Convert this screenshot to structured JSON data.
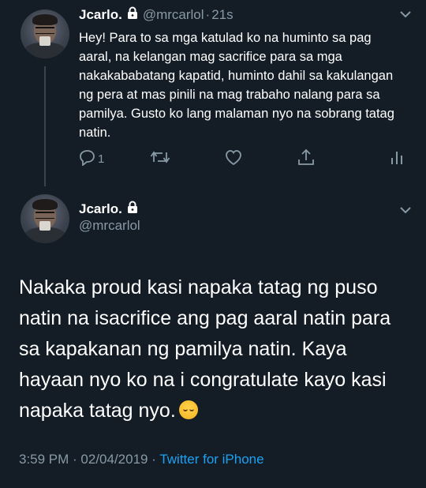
{
  "reply_tweet": {
    "author_name": "Jcarlo.",
    "handle": "@mrcarlol",
    "time": "21s",
    "text": "Hey! Para to sa mga katulad ko na huminto sa pag aaral, na kelangan mag sacrifice para sa mga nakakababatang kapatid, huminto dahil sa kakulangan ng pera at mas pinili na mag trabaho nalang para sa pamilya. Gusto ko lang malaman nyo na sobrang tatag natin.",
    "reply_count": "1",
    "icons": [
      "reply-icon",
      "retweet-icon",
      "like-icon",
      "share-icon",
      "analytics-icon"
    ]
  },
  "main_tweet": {
    "author_name": "Jcarlo.",
    "handle": "@mrcarlol",
    "text": "Nakaka proud kasi napaka tatag ng puso natin na isacrifice ang pag aaral natin para sa kapakanan ng pamilya natin. Kaya hayaan nyo ko na i congratulate kayo kasi napaka tatag nyo.",
    "emoji": "relieved-smile-emoji",
    "timestamp": "3:59 PM · 02/04/2019 · ",
    "source": "Twitter for iPhone"
  },
  "colors": {
    "background": "#141d26",
    "secondary_text": "#8899a6",
    "link": "#1da1f2",
    "thread_line": "#38444d"
  }
}
